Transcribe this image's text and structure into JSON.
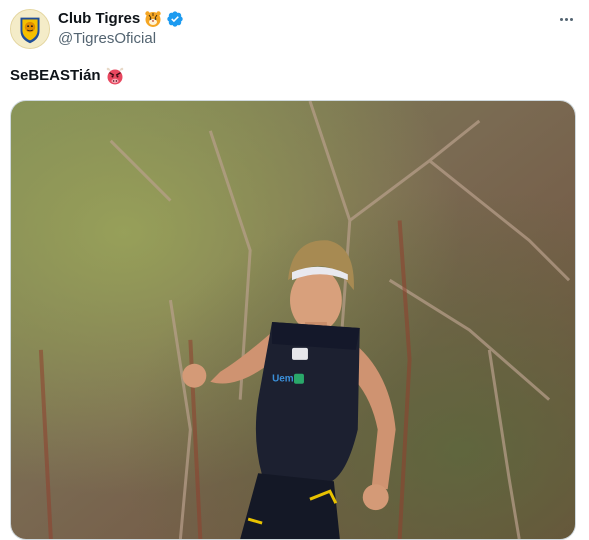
{
  "author": {
    "name": "Club Tigres",
    "handle": "@TigresOficial",
    "name_emoji": "tiger-face-icon",
    "verified": true
  },
  "tweet": {
    "text": "SeBEASTián",
    "text_emoji": "angry-bull-face-icon"
  },
  "media": {
    "description_icon": "photo-player-training",
    "jersey_print": "Uemu"
  },
  "colors": {
    "verified_blue": "#1d9bf0",
    "secondary_text": "#536471",
    "border": "#cfd9de"
  }
}
